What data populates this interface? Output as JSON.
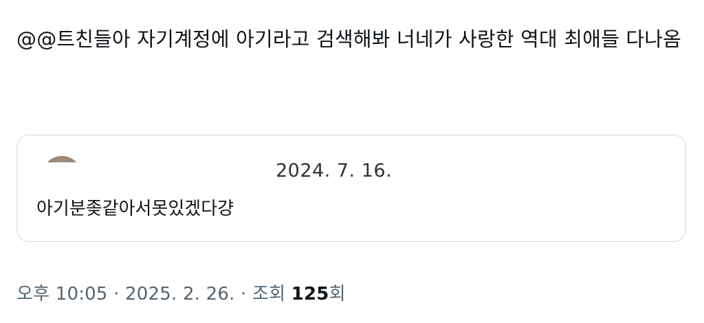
{
  "tweet": {
    "text": "@@트친들아 자기계정에 아기라고 검색해봐 너네가 사랑한 역대 최애들 다나옴"
  },
  "quote": {
    "date": "2024. 7. 16.",
    "text": "아기분좆같아서못있겠다걍"
  },
  "meta": {
    "time": "오후 10:05",
    "separator": "·",
    "date": "2025. 2. 26.",
    "views_label": "조회",
    "views_count": "125",
    "views_suffix": "회"
  }
}
